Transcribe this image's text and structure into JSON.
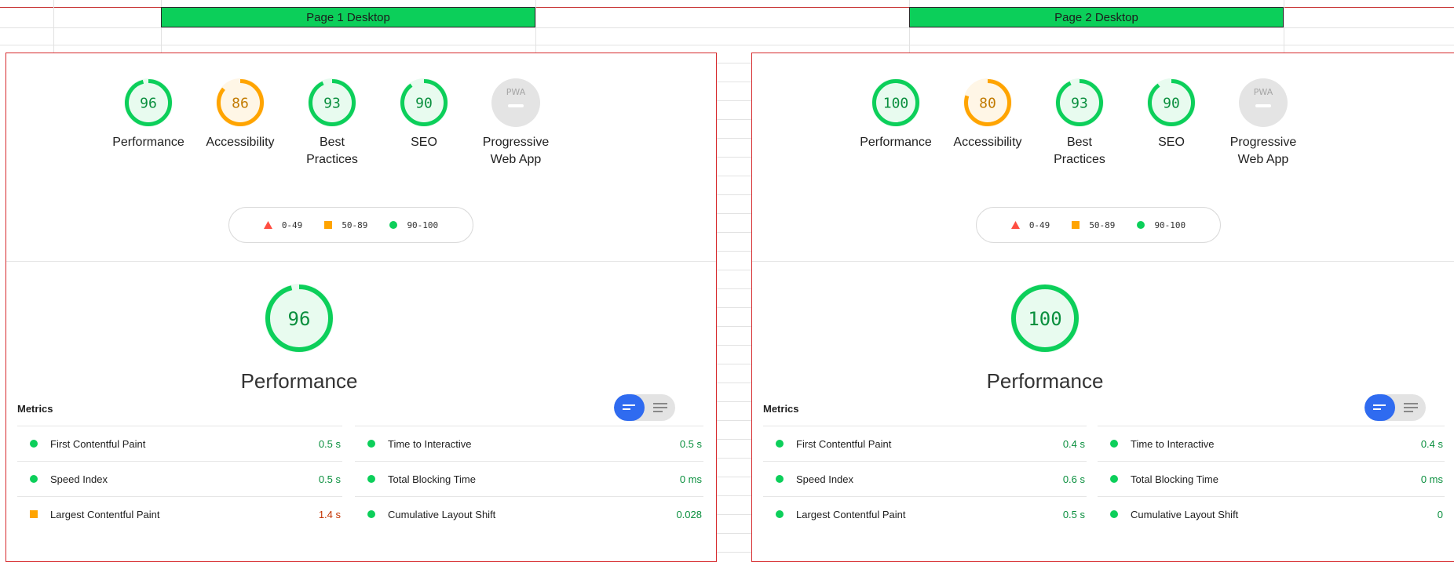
{
  "sheet": {
    "headers": [
      "Page 1 Desktop",
      "Page 2 Desktop"
    ]
  },
  "colors": {
    "good": "#0ccf5a",
    "average": "#ffa400",
    "poor": "#ff4e42",
    "pwa_gray": "#e0e0e0",
    "panel_border": "#d6292c",
    "header_fill": "#0ccf5a",
    "toggle_active": "#2f6bf0"
  },
  "reports": [
    {
      "categories": [
        {
          "score": "96",
          "label_line1": "Performance",
          "label_line2": "",
          "rating": "good"
        },
        {
          "score": "86",
          "label_line1": "Accessibility",
          "label_line2": "",
          "rating": "average"
        },
        {
          "score": "93",
          "label_line1": "Best",
          "label_line2": "Practices",
          "rating": "good"
        },
        {
          "score": "90",
          "label_line1": "SEO",
          "label_line2": "",
          "rating": "good"
        },
        {
          "score": "PWA",
          "label_line1": "Progressive",
          "label_line2": "Web App",
          "rating": "pwa"
        }
      ],
      "legend": [
        "0-49",
        "50-89",
        "90-100"
      ],
      "performance_score": "96",
      "performance_title": "Performance",
      "metrics_title": "Metrics",
      "metrics_left": [
        {
          "name": "First Contentful Paint",
          "value": "0.5 s",
          "rating": "good"
        },
        {
          "name": "Speed Index",
          "value": "0.5 s",
          "rating": "good"
        },
        {
          "name": "Largest Contentful Paint",
          "value": "1.4 s",
          "rating": "average"
        }
      ],
      "metrics_right": [
        {
          "name": "Time to Interactive",
          "value": "0.5 s",
          "rating": "good"
        },
        {
          "name": "Total Blocking Time",
          "value": "0 ms",
          "rating": "good"
        },
        {
          "name": "Cumulative Layout Shift",
          "value": "0.028",
          "rating": "good"
        }
      ]
    },
    {
      "categories": [
        {
          "score": "100",
          "label_line1": "Performance",
          "label_line2": "",
          "rating": "good"
        },
        {
          "score": "80",
          "label_line1": "Accessibility",
          "label_line2": "",
          "rating": "average"
        },
        {
          "score": "93",
          "label_line1": "Best",
          "label_line2": "Practices",
          "rating": "good"
        },
        {
          "score": "90",
          "label_line1": "SEO",
          "label_line2": "",
          "rating": "good"
        },
        {
          "score": "PWA",
          "label_line1": "Progressive",
          "label_line2": "Web App",
          "rating": "pwa"
        }
      ],
      "legend": [
        "0-49",
        "50-89",
        "90-100"
      ],
      "performance_score": "100",
      "performance_title": "Performance",
      "metrics_title": "Metrics",
      "metrics_left": [
        {
          "name": "First Contentful Paint",
          "value": "0.4 s",
          "rating": "good"
        },
        {
          "name": "Speed Index",
          "value": "0.6 s",
          "rating": "good"
        },
        {
          "name": "Largest Contentful Paint",
          "value": "0.5 s",
          "rating": "good"
        }
      ],
      "metrics_right": [
        {
          "name": "Time to Interactive",
          "value": "0.4 s",
          "rating": "good"
        },
        {
          "name": "Total Blocking Time",
          "value": "0 ms",
          "rating": "good"
        },
        {
          "name": "Cumulative Layout Shift",
          "value": "0",
          "rating": "good"
        }
      ]
    }
  ]
}
